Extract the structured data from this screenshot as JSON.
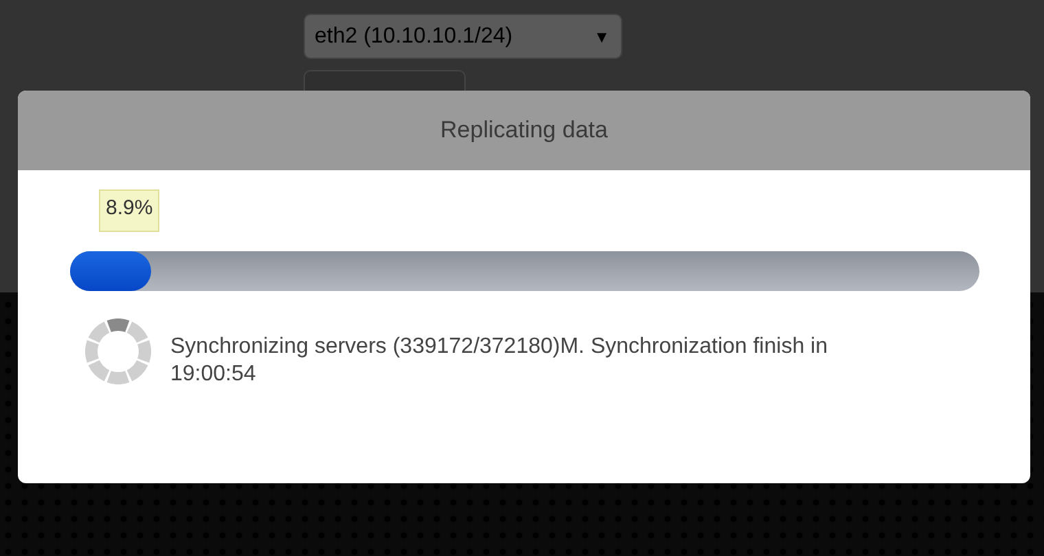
{
  "background": {
    "interface_select": {
      "value": "eth2 (10.10.10.1/24)",
      "caret": "▼"
    }
  },
  "dialog": {
    "title": "Replicating data",
    "progress": {
      "badge": "8.9%",
      "level": 0.089
    },
    "message": "Synchronizing servers (339172/372180)M. Synchronization finish in 19:00:54"
  }
}
